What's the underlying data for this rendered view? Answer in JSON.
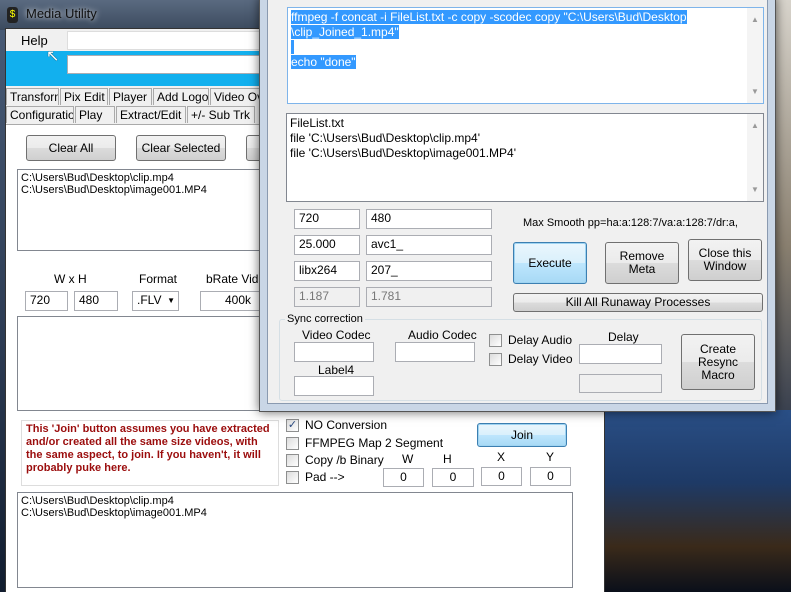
{
  "main_window": {
    "title": "Media Utility",
    "menu": {
      "help": "Help"
    },
    "tabs_row1": [
      "Transform",
      "Pix Edit",
      "Player",
      "Add Logo",
      "Video Ove"
    ],
    "tabs_row2": [
      "Configuration",
      "Play",
      "Extract/Edit",
      "+/- Sub Trk"
    ],
    "buttons": {
      "clear_all": "Clear All",
      "clear_selected": "Clear Selected",
      "join": "Join"
    },
    "file_list": [
      "C:\\Users\\Bud\\Desktop\\clip.mp4",
      "C:\\Users\\Bud\\Desktop\\image001.MP4"
    ],
    "size": {
      "label": "W x H",
      "width": "720",
      "height": "480"
    },
    "format": {
      "label": "Format",
      "value": ".FLV"
    },
    "bitrate": {
      "label": "bRate Vide",
      "value": "400k"
    },
    "join_note": "This 'Join' button assumes you have extracted  and/or created all the same size videos, with the same aspect,  to join.  If you haven't, it will probably puke here.",
    "options": [
      {
        "label": "NO Conversion",
        "checked": true
      },
      {
        "label": "FFMPEG Map 2 Segment",
        "checked": false
      },
      {
        "label": "Copy /b Binary",
        "checked": false
      },
      {
        "label": "Pad  -->",
        "checked": false
      }
    ],
    "pad": {
      "w_label": "W",
      "h_label": "H",
      "x_label": "X",
      "y_label": "Y",
      "w": "0",
      "h": "0",
      "x": "0",
      "y": "0"
    },
    "join_list": [
      "C:\\Users\\Bud\\Desktop\\clip.mp4",
      "C:\\Users\\Bud\\Desktop\\image001.MP4"
    ]
  },
  "dialog": {
    "command_lines": [
      "ffmpeg -f concat -i FileList.txt -c copy -scodec copy \"C:\\Users\\Bud\\Desktop",
      "\\clip_Joined_1.mp4\"",
      "echo \"done\""
    ],
    "filelist_lines": [
      "FileList.txt",
      "file 'C:\\Users\\Bud\\Desktop\\clip.mp4'",
      "file 'C:\\Users\\Bud\\Desktop\\image001.MP4'"
    ],
    "fields": {
      "width": "720",
      "height": "480",
      "fps": "25.000",
      "vcodec_tag": "avc1_",
      "encoder": "libx264",
      "num": "207_",
      "ratio1": "1.187",
      "ratio2": "1.781"
    },
    "max_smooth": "Max Smooth pp=ha:a:128:7/va:a:128:7/dr:a,",
    "buttons": {
      "execute": "Execute",
      "remove_meta": "Remove Meta",
      "close": "Close this Window",
      "kill": "Kill All Runaway Processes",
      "resync": "Create Resync Macro"
    },
    "sync": {
      "group": "Sync correction",
      "video_codec": "Video Codec",
      "audio_codec": "Audio Codec",
      "label4": "Label4",
      "delay": "Delay",
      "delay_audio": "Delay Audio",
      "delay_video": "Delay Video"
    }
  }
}
